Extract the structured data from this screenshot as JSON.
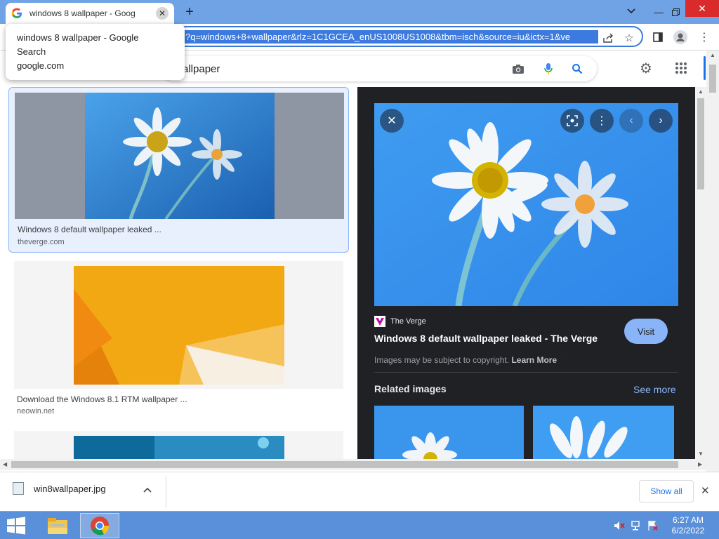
{
  "browser": {
    "tab_title": "windows 8 wallpaper - Google Search",
    "tab_title_visible": "windows 8 wallpaper - Google Se",
    "url": "?q=windows+8+wallpaper&rlz=1C1GCEA_enUS1008US1008&tbm=isch&source=iu&ictx=1&ve",
    "tooltip": {
      "title": "windows 8 wallpaper - Google Search",
      "url": "google.com"
    }
  },
  "search": {
    "query_visible": "allpaper"
  },
  "results": [
    {
      "caption": "Windows 8 default wallpaper leaked ...",
      "domain": "theverge.com"
    },
    {
      "caption": "Download the Windows 8.1 RTM wallpaper ...",
      "domain": "neowin.net"
    }
  ],
  "preview": {
    "source": "The Verge",
    "title": "Windows 8 default wallpaper leaked - The Verge",
    "visit_label": "Visit",
    "copyright_text": "Images may be subject to copyright.",
    "learn_more": "Learn More",
    "related_label": "Related images",
    "see_more": "See more"
  },
  "downloads": {
    "file_name": "win8wallpaper.jpg",
    "show_all": "Show all"
  },
  "taskbar": {
    "time": "6:27 AM",
    "date": "6/2/2022"
  },
  "colors": {
    "tabstrip": "#6fa3e6",
    "accent": "#1a73e8",
    "panel_bg": "#202124",
    "visit_button": "#8ab4f8",
    "taskbar": "#5a8fd9",
    "close_button": "#d92b2b"
  }
}
